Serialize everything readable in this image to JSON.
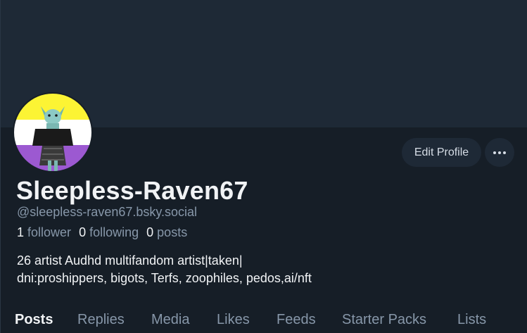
{
  "profile": {
    "display_name": "Sleepless-Raven67",
    "handle": "@sleepless-raven67.bsky.social",
    "bio_line1": "26 artist Audhd multifandom artist|taken|",
    "bio_line2": "dni:proshippers, bigots, Terfs, zoophiles, pedos,ai/nft"
  },
  "stats": {
    "followers_count": "1",
    "followers_label": "follower",
    "following_count": "0",
    "following_label": "following",
    "posts_count": "0",
    "posts_label": "posts"
  },
  "actions": {
    "edit_profile_label": "Edit Profile",
    "more_icon": "ellipsis-icon"
  },
  "tabs": [
    {
      "label": "Posts",
      "active": true
    },
    {
      "label": "Replies",
      "active": false
    },
    {
      "label": "Media",
      "active": false
    },
    {
      "label": "Likes",
      "active": false
    },
    {
      "label": "Feeds",
      "active": false
    },
    {
      "label": "Starter Packs",
      "active": false
    },
    {
      "label": "Lists",
      "active": false
    }
  ],
  "colors": {
    "background": "#161e27",
    "banner": "#1e2936",
    "muted_text": "#8797a9",
    "flag_yellow": "#fcf434",
    "flag_white": "#ffffff",
    "flag_purple": "#9c59d1"
  }
}
